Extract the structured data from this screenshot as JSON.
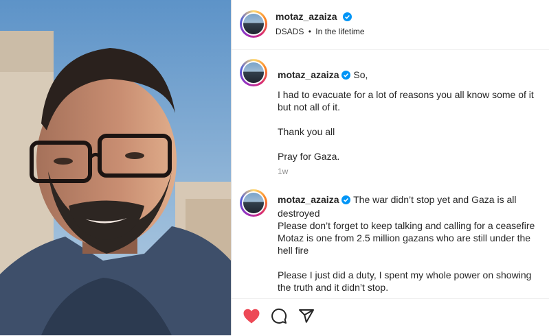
{
  "post": {
    "username": "motaz_azaiza",
    "subtitle_left": "DSADS",
    "subtitle_right": "In the lifetime",
    "separator": "•"
  },
  "comments": [
    {
      "username": "motaz_azaiza",
      "text_first": "So,",
      "text_rest": "I had to evacuate for a lot of reasons you all know some of it\nbut not all of it.\n\nThank you all\n\nPray for Gaza.",
      "time": "1w"
    },
    {
      "username": "motaz_azaiza",
      "text_first": "The war didn’t stop yet and Gaza is all\ndestroyed\nPlease don’t forget to keep talking and calling for a ceasefire\nMotaz is one from 2.5 million gazans who are still under the\nhell fire\n\nPlease I just did a duty, I spent my whole power on showing\nthe truth and it didn’t stop.",
      "text_rest": ""
    }
  ],
  "icons": {
    "like": "heart-icon",
    "comment": "comment-icon",
    "share": "share-icon",
    "verified": "verified-badge-icon"
  },
  "colors": {
    "like": "#ed4956",
    "verified": "#0095f6"
  }
}
